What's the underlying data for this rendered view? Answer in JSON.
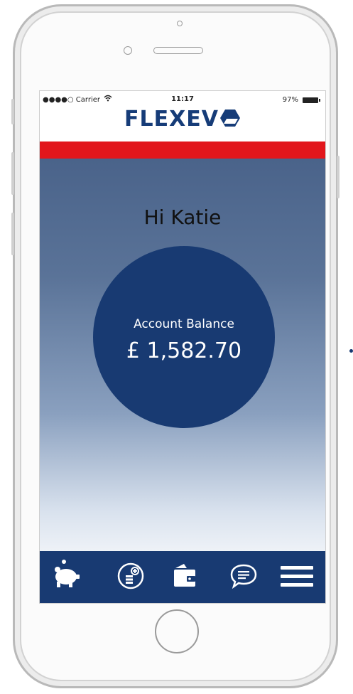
{
  "status_bar": {
    "carrier": "●●●●○ Carrier",
    "time": "11:17",
    "battery": "97%"
  },
  "brand": {
    "name": "FLEXEV"
  },
  "main": {
    "greeting": "Hi Katie",
    "balance_label": "Account Balance",
    "balance_value": "£ 1,582.70"
  },
  "nav": {
    "items": [
      {
        "icon": "piggy-bank-icon"
      },
      {
        "icon": "coins-add-icon"
      },
      {
        "icon": "wallet-icon"
      },
      {
        "icon": "chat-icon"
      },
      {
        "icon": "menu-icon"
      }
    ]
  },
  "colors": {
    "brand_blue": "#183a72",
    "accent_red": "#e2161c",
    "text_dark": "#111111"
  }
}
